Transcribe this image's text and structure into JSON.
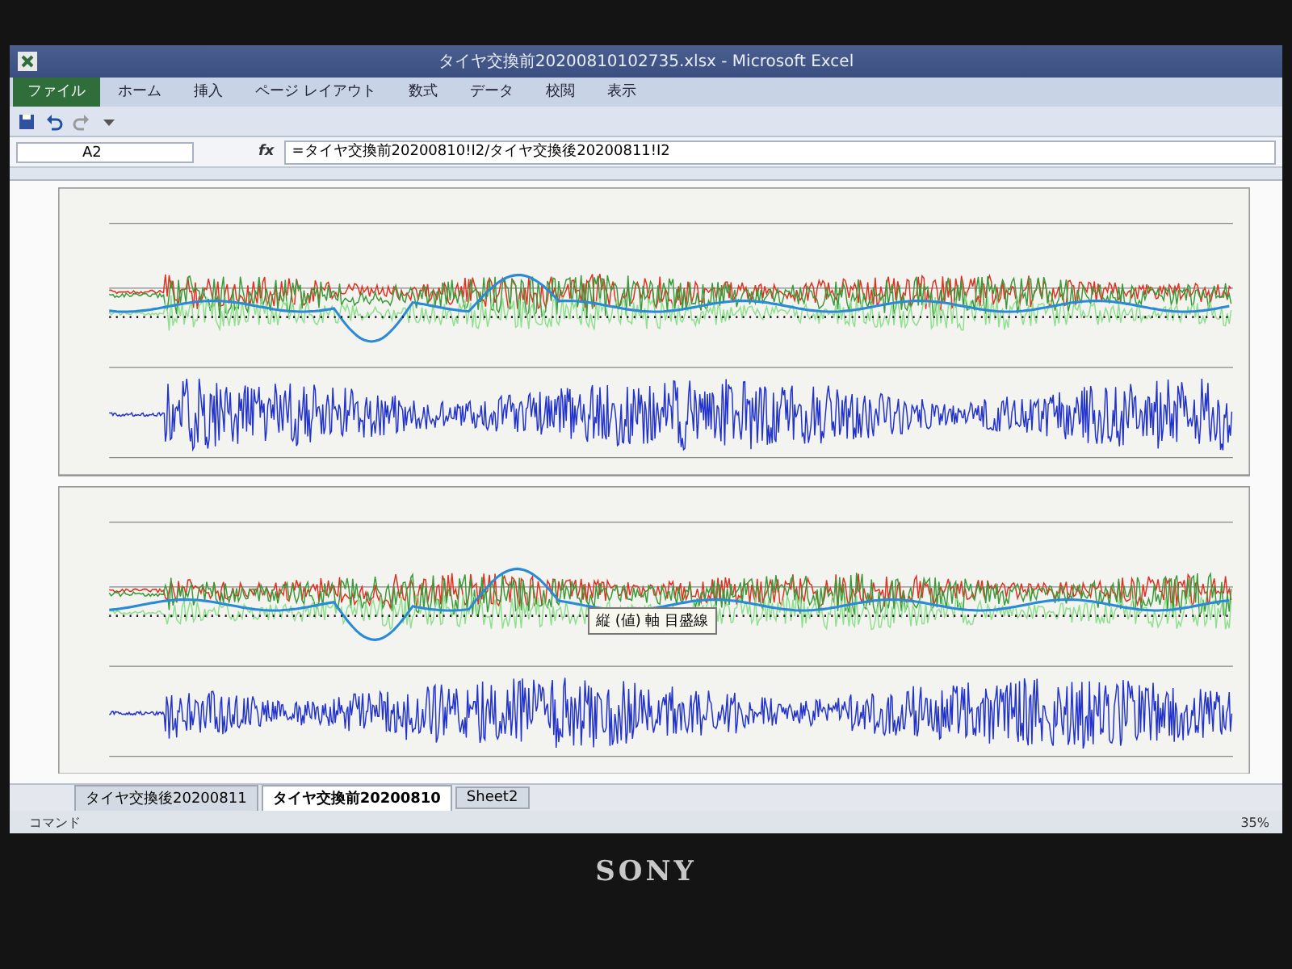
{
  "window": {
    "title": "タイヤ交換前20200810102735.xlsx - Microsoft Excel"
  },
  "ribbon_tabs": [
    {
      "label": "ファイル",
      "kind": "file",
      "selected": false
    },
    {
      "label": "ホーム",
      "kind": "tab",
      "selected": false
    },
    {
      "label": "挿入",
      "kind": "tab",
      "selected": false
    },
    {
      "label": "ページ レイアウト",
      "kind": "tab",
      "selected": false
    },
    {
      "label": "数式",
      "kind": "tab",
      "selected": false
    },
    {
      "label": "データ",
      "kind": "tab",
      "selected": false
    },
    {
      "label": "校閲",
      "kind": "tab",
      "selected": false
    },
    {
      "label": "表示",
      "kind": "tab",
      "selected": false
    }
  ],
  "formula_bar": {
    "name_box": "A2",
    "fx": "fx",
    "formula": "=タイヤ交換前20200810!I2/タイヤ交換後20200811!I2"
  },
  "tooltip": "縦 (値) 軸 目盛線",
  "sheet_tabs": [
    {
      "label": "タイヤ交換後20200811",
      "selected": false
    },
    {
      "label": "タイヤ交換前20200810",
      "selected": true
    },
    {
      "label": "Sheet2",
      "selected": false
    }
  ],
  "status_bar": {
    "mode": "コマンド",
    "zoom": "35%"
  },
  "bezel": {
    "brand": "SONY"
  }
}
